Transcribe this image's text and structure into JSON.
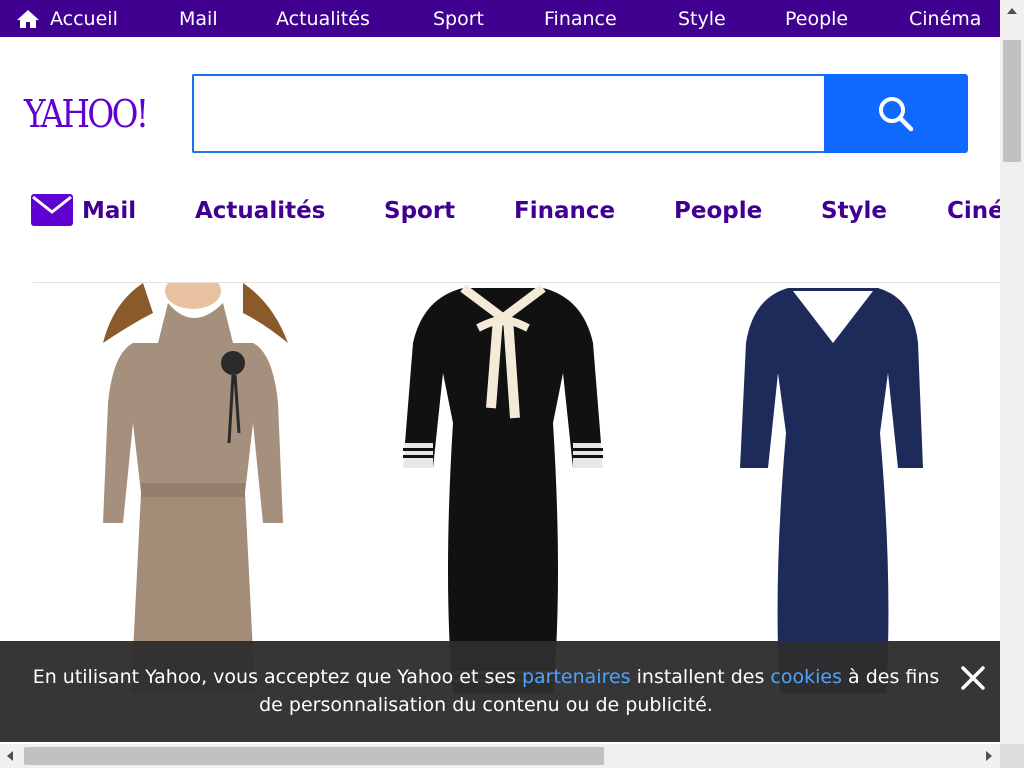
{
  "topbar": {
    "items": [
      "Accueil",
      "Mail",
      "Actualités",
      "Sport",
      "Finance",
      "Style",
      "People",
      "Cinéma"
    ]
  },
  "logo": {
    "text": "YAHOO!"
  },
  "search": {
    "value": "",
    "placeholder": ""
  },
  "subnav": {
    "items": [
      "Mail",
      "Actualités",
      "Sport",
      "Finance",
      "People",
      "Style",
      "Ciné"
    ]
  },
  "cookie": {
    "part1": "En utilisant Yahoo, vous acceptez que Yahoo et ses ",
    "link1": "partenaires",
    "part2": " installent des ",
    "link2": "cookies",
    "part3": " à des fins de personnalisation du contenu ou de publicité."
  },
  "colors": {
    "brand_purple": "#400090",
    "search_blue": "#0f69ff",
    "link_blue": "#4fa3ff"
  }
}
